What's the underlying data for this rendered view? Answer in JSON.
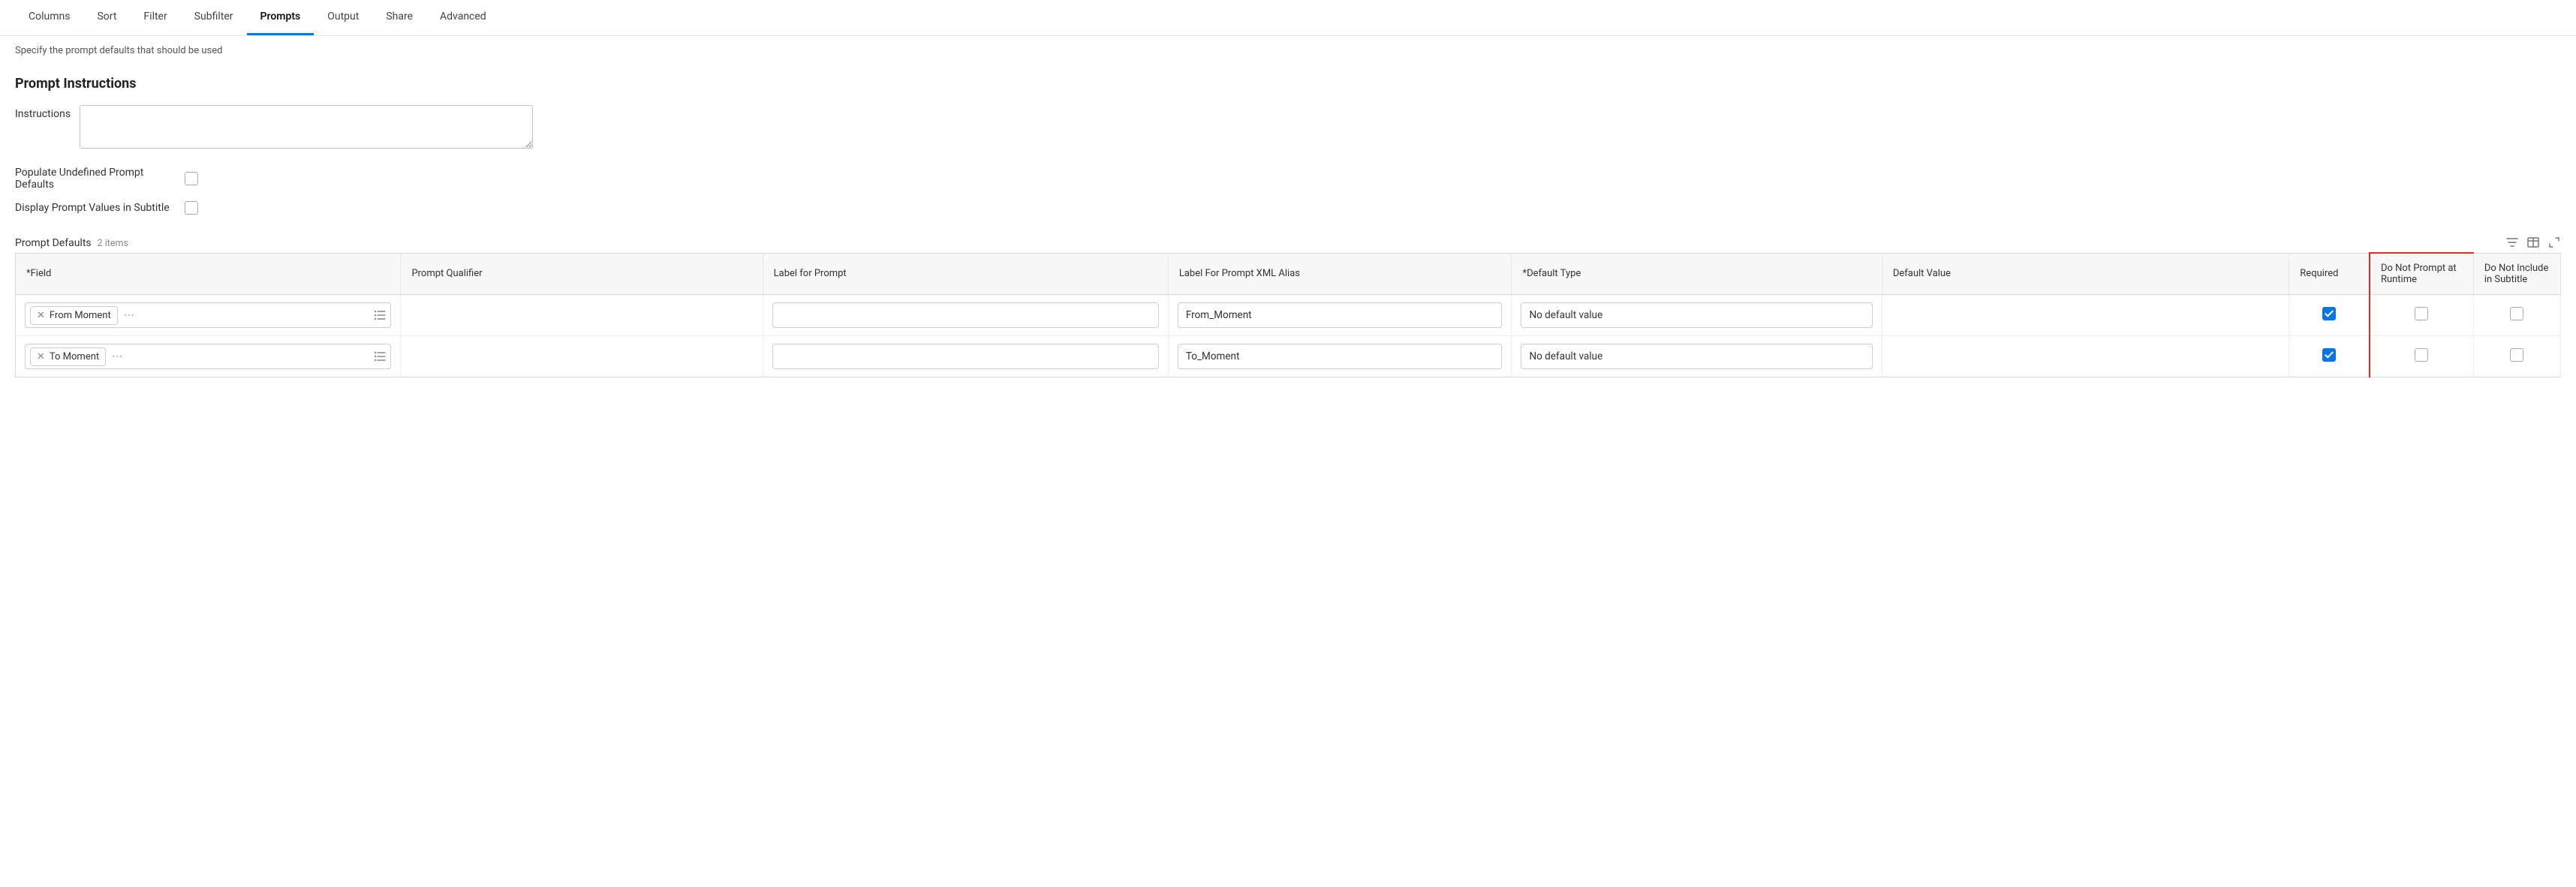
{
  "tabs": {
    "columns": "Columns",
    "sort": "Sort",
    "filter": "Filter",
    "subfilter": "Subfilter",
    "prompts": "Prompts",
    "output": "Output",
    "share": "Share",
    "advanced": "Advanced"
  },
  "description": "Specify the prompt defaults that should be used",
  "section_title": "Prompt Instructions",
  "instructions_label": "Instructions",
  "instructions_value": "",
  "populate_label": "Populate Undefined Prompt Defaults",
  "populate_checked": false,
  "display_label": "Display Prompt Values in Subtitle",
  "display_checked": false,
  "prompt_defaults": {
    "title": "Prompt Defaults",
    "count": "2 items",
    "columns": {
      "field": "*Field",
      "qualifier": "Prompt Qualifier",
      "label": "Label for Prompt",
      "alias": "Label For Prompt XML Alias",
      "default_type": "*Default Type",
      "default_value": "Default Value",
      "required": "Required",
      "no_prompt": "Do Not Prompt at Runtime",
      "no_subtitle": "Do Not Include in Subtitle"
    },
    "rows": [
      {
        "field": "From Moment",
        "qualifier": "",
        "label": "",
        "alias": "From_Moment",
        "default_type": "No default value",
        "default_value": "",
        "required": true,
        "no_prompt": false,
        "no_subtitle": false
      },
      {
        "field": "To Moment",
        "qualifier": "",
        "label": "",
        "alias": "To_Moment",
        "default_type": "No default value",
        "default_value": "",
        "required": true,
        "no_prompt": false,
        "no_subtitle": false
      }
    ]
  }
}
